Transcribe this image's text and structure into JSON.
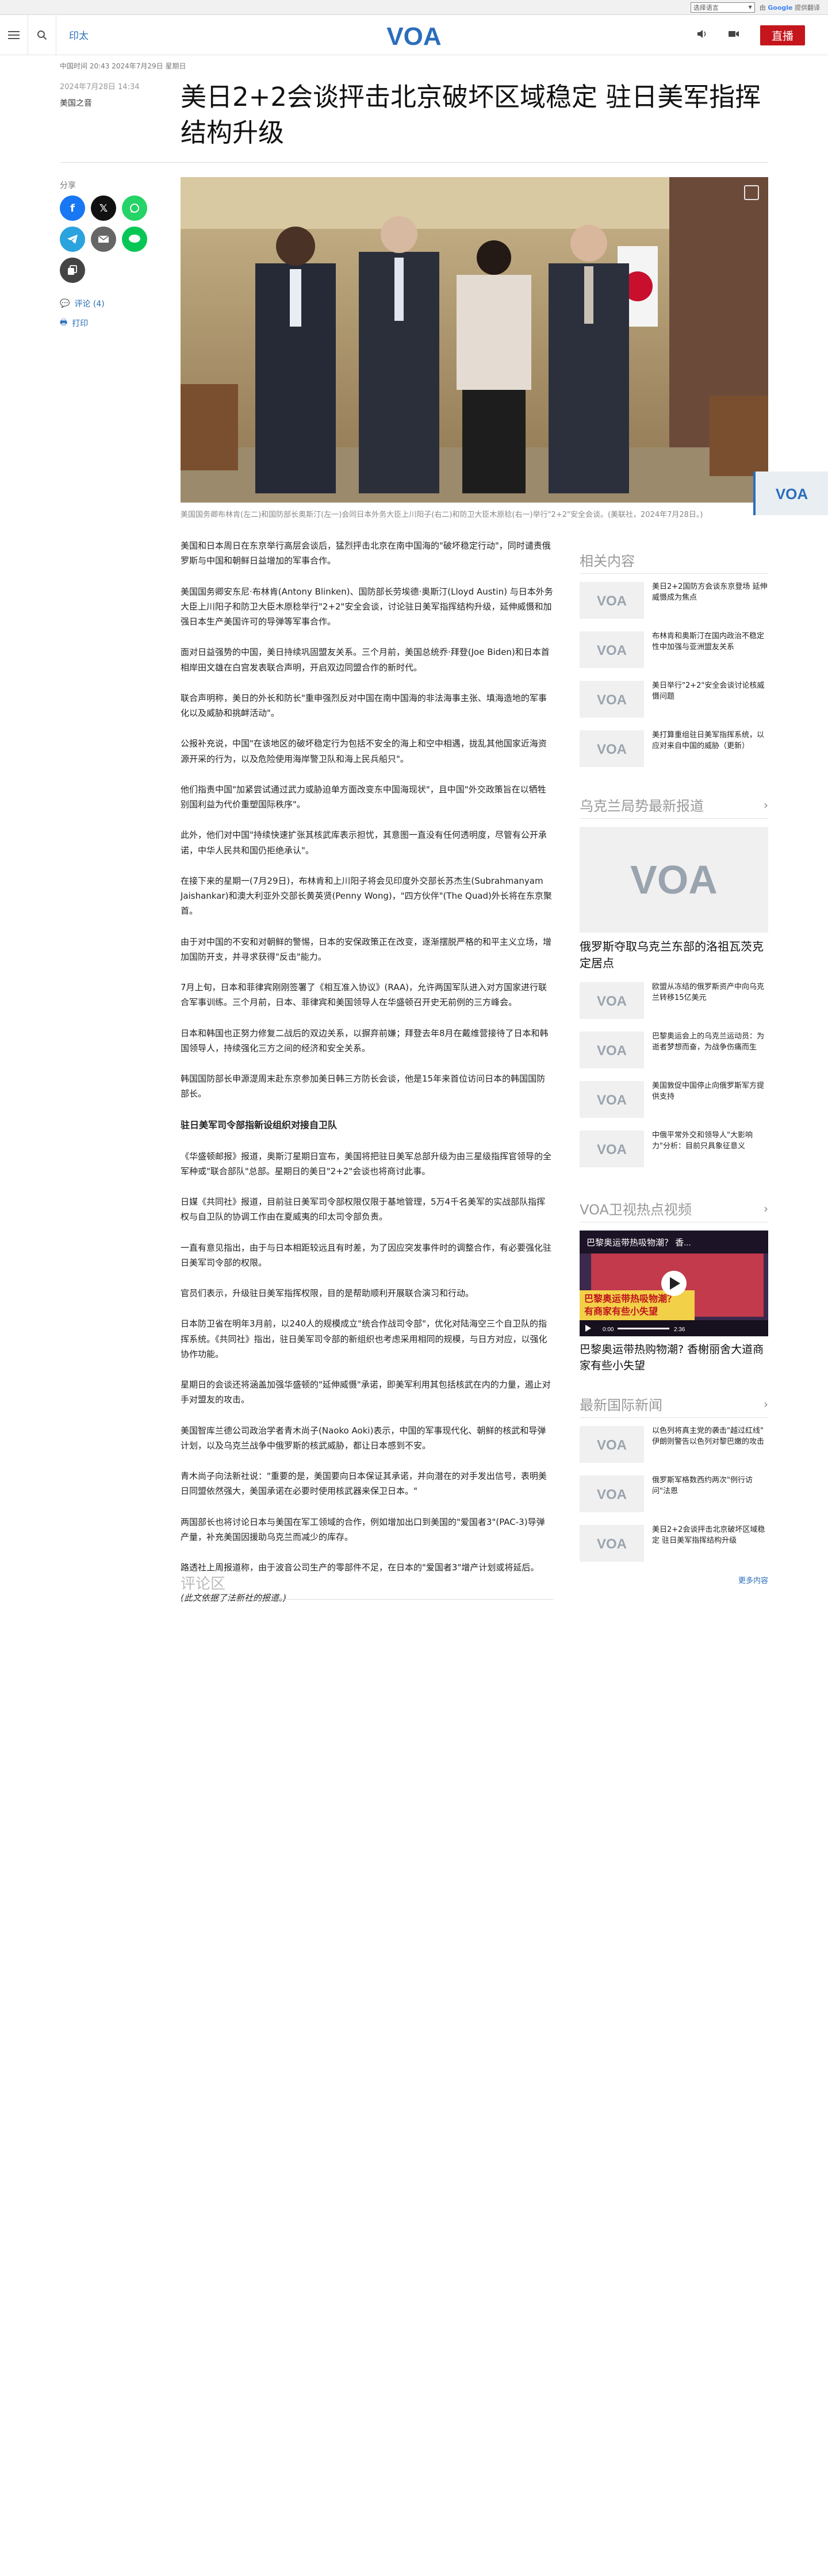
{
  "google_translate": {
    "select_label": "选择语言",
    "powered_prefix": "由",
    "powered_brand": "Google",
    "powered_suffix": "提供翻译"
  },
  "header": {
    "region": "印太",
    "logo_text": "VOA",
    "live_label": "直播"
  },
  "meta": {
    "pub_dates": "中国时间 20:43 2024年7月29日 星期日",
    "date": "2024年7月28日 14:34",
    "byline": "美国之音"
  },
  "article": {
    "title": "美日2+2会谈抨击北京破坏区域稳定 驻日美军指挥结构升级",
    "image_caption": "美国国务卿布林肯(左二)和国防部长奥斯汀(左一)会同日本外务大臣上川阳子(右二)和防卫大臣木原稔(右一)举行\"2+2\"安全会谈。(美联社，2024年7月28日。)",
    "paragraphs": [
      "美国和日本周日在东京举行高层会谈后，猛烈抨击北京在南中国海的\"破坏稳定行动\"，同时谴责俄罗斯与中国和朝鲜日益增加的军事合作。",
      "美国国务卿安东尼·布林肯(Antony Blinken)、国防部长劳埃德·奥斯汀(Lloyd Austin) 与日本外务大臣上川阳子和防卫大臣木原稔举行\"2+2\"安全会谈，讨论驻日美军指挥结构升级，延伸威慑和加强日本生产美国许可的导弹等军事合作。",
      "面对日益强势的中国，美日持续巩固盟友关系。三个月前，美国总统乔·拜登(Joe Biden)和日本首相岸田文雄在白宫发表联合声明，开启双边同盟合作的新时代。",
      "联合声明称，美日的外长和防长\"重申强烈反对中国在南中国海的非法海事主张、填海造地的军事化以及威胁和挑衅活动\"。",
      "公报补充说，中国\"在该地区的破坏稳定行为包括不安全的海上和空中相遇，拢乱其他国家近海资源开采的行为，以及危险使用海岸警卫队和海上民兵船只\"。",
      "他们指责中国\"加紧尝试通过武力或胁迫单方面改变东中国海现状\"，且中国\"外交政策旨在以牺牲别国利益为代价重塑国际秩序\"。",
      "此外，他们对中国\"持续快速扩张其核武库表示担忧，其意图一直没有任何透明度，尽管有公开承诺，中华人民共和国仍拒绝承认\"。",
      "在接下来的星期一(7月29日)，布林肯和上川阳子将会见印度外交部长苏杰生(Subrahmanyam Jaishankar)和澳大利亚外交部长黄英贤(Penny Wong)，\"四方伙伴\"(The Quad)外长将在东京聚首。",
      "由于对中国的不安和对朝鲜的警惕，日本的安保政策正在改变，逐渐摆脱严格的和平主义立场，增加国防开支，并寻求获得\"反击\"能力。",
      "7月上旬，日本和菲律宾刚刚签署了《相互准入协议》(RAA)，允许两国军队进入对方国家进行联合军事训练。三个月前，日本、菲律宾和美国领导人在华盛顿召开史无前例的三方峰会。",
      "日本和韩国也正努力修复二战后的双边关系，以摒弃前嫌；拜登去年8月在戴维营接待了日本和韩国领导人，持续强化三方之间的经济和安全关系。",
      "韩国国防部长申源湜周末赴东京参加美日韩三方防长会谈，他是15年来首位访问日本的韩国国防部长。"
    ],
    "subheading": "驻日美军司令部指新设组织对接自卫队",
    "paragraphs_2": [
      "《华盛顿邮报》报道，奥斯汀星期日宣布，美国将把驻日美军总部升级为由三星级指挥官领导的全军种或\"联合部队\"总部。星期日的美日\"2+2\"会谈也将商讨此事。",
      "日媒《共同社》报道，目前驻日美军司令部权限仅限于基地管理，5万4千名美军的实战部队指挥权与自卫队的协调工作由在夏威夷的印太司令部负责。",
      "一直有意见指出，由于与日本相距较远且有时差，为了因应突发事件时的调整合作，有必要强化驻日美军司令部的权限。",
      "官员们表示，升级驻日美军指挥权限，目的是帮助顺利开展联合演习和行动。",
      "日本防卫省在明年3月前，以240人的规模成立\"统合作战司令部\"，优化对陆海空三个自卫队的指挥系统。《共同社》指出，驻日美军司令部的新组织也考虑采用相同的规模，与日方对应，以强化协作功能。",
      "星期日的会谈还将涵盖加强华盛顿的\"延伸威慑\"承诺，即美军利用其包括核武在内的力量，遏止对手对盟友的攻击。",
      "美国智库兰德公司政治学者青木尚子(Naoko Aoki)表示，中国的军事现代化、朝鲜的核武和导弹计划，以及乌克兰战争中俄罗斯的核武威胁，都让日本感到不安。",
      "青木尚子向法新社说：\"重要的是，美国要向日本保证其承诺，并向潜在的对手发出信号，表明美日同盟依然强大，美国承诺在必要时使用核武器来保卫日本。\"",
      "两国部长也将讨论日本与美国在军工领域的合作，例如增加出口到美国的\"爱国者3\"(PAC-3)导弹产量，补充美国因援助乌克兰而减少的库存。",
      "路透社上周报道称，由于波音公司生产的零部件不足，在日本的\"爱国者3\"增产计划或将延后。"
    ],
    "note": "(此文依据了法新社的报道。)",
    "comments_heading": "评论区"
  },
  "share": {
    "label": "分享",
    "comments_link": "评论 (4)",
    "print_link": "打印"
  },
  "related": {
    "heading": "相关内容",
    "items": [
      "美日2+2国防方会谈东京登场 延伸威慑成为焦点",
      "布林肯和奥斯汀在国内政治不稳定性中加强与亚洲盟友关系",
      "美日举行\"2+2\"安全会谈讨论核威慑问题",
      "美打算重组驻日美军指挥系统，以应对来自中国的威胁（更新）"
    ]
  },
  "ukraine": {
    "heading": "乌克兰局势最新报道",
    "lead_title": "俄罗斯夺取乌克兰东部的洛祖瓦茨克定居点",
    "items": [
      "欧盟从冻结的俄罗斯资产中向乌克兰转移15亿美元",
      "巴黎奥运会上的乌克兰运动员：为逝者梦想而奋，为战争伤痛而生",
      "美国敦促中国停止向俄罗斯军方提供支持",
      "中俄平常外交和领导人\"大影响力\"分析：目前只具象征意义"
    ]
  },
  "video": {
    "heading": "VOA卫视热点视频",
    "overlay_title": "巴黎奥运带热吸物潮？ 香...",
    "banner_line1": "巴黎奥运带热吸物潮？",
    "banner_line2": "有商家有些小失望",
    "time_current": "0:00",
    "time_total": "2:36",
    "caption": "巴黎奥运带热购物潮? 香榭丽舍大道商家有些小失望"
  },
  "intl": {
    "heading": "最新国际新闻",
    "items": [
      "以色列将真主党的袭击\"越过红线\" 伊朗则警告以色列对黎巴嫩的攻击",
      "俄罗斯军格数西约两次\"例行访问\"法恩",
      "美日2+2会谈抨击北京破坏区域稳定 驻日美军指挥结构升级"
    ],
    "more": "更多内容"
  }
}
